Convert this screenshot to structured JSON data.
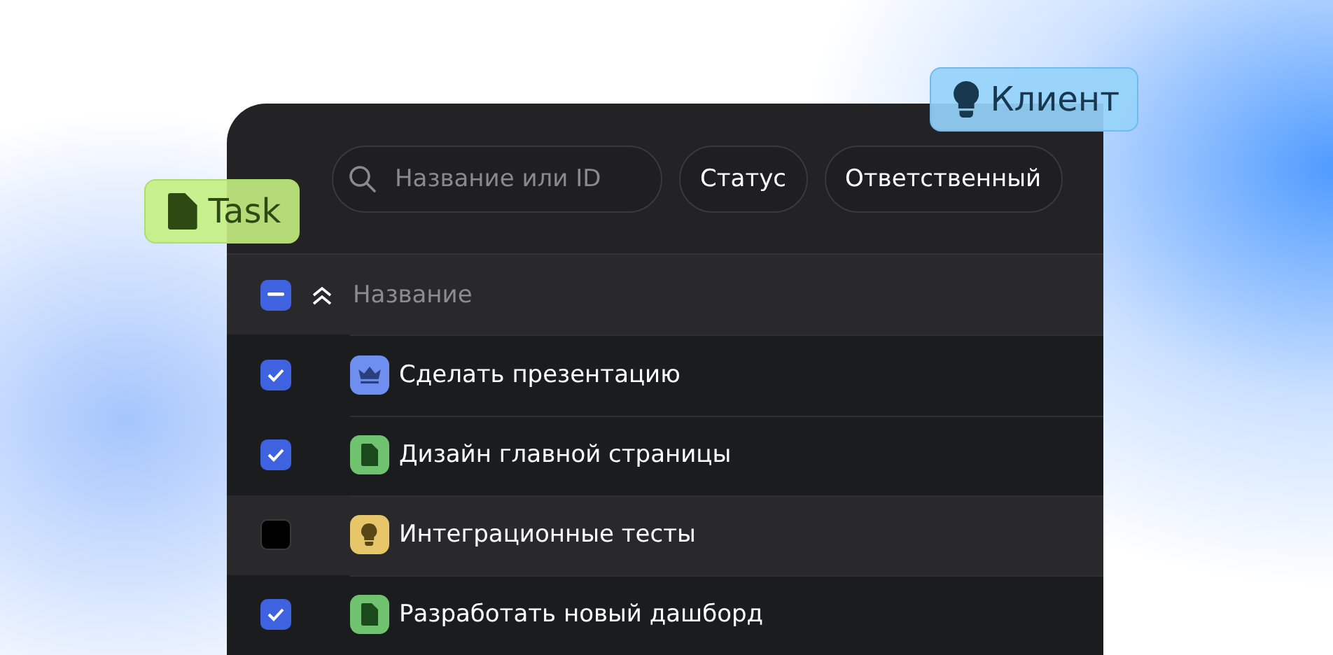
{
  "toolbar": {
    "search": {
      "placeholder": "Название или ID"
    },
    "filters": [
      "Статус",
      "Ответственный"
    ]
  },
  "table": {
    "header": {
      "label": "Название",
      "select_all": {
        "checked": true,
        "indeterminate": true
      }
    },
    "rows": [
      {
        "title": "Сделать презентацию",
        "checked": true,
        "highlighted": false,
        "kind": "crown",
        "color": "#6f8ff0"
      },
      {
        "title": "Дизайн главной страницы",
        "checked": true,
        "highlighted": false,
        "kind": "doc",
        "color": "#6fc36f"
      },
      {
        "title": "Интеграционные тесты",
        "checked": false,
        "highlighted": true,
        "kind": "bulb",
        "color": "#e7c66a"
      },
      {
        "title": "Разработать новый дашборд",
        "checked": true,
        "highlighted": false,
        "kind": "doc",
        "color": "#6fc36f"
      }
    ]
  },
  "tags": [
    {
      "label": "Task",
      "kind": "doc"
    },
    {
      "label": "Клиент",
      "kind": "bulb"
    }
  ]
}
